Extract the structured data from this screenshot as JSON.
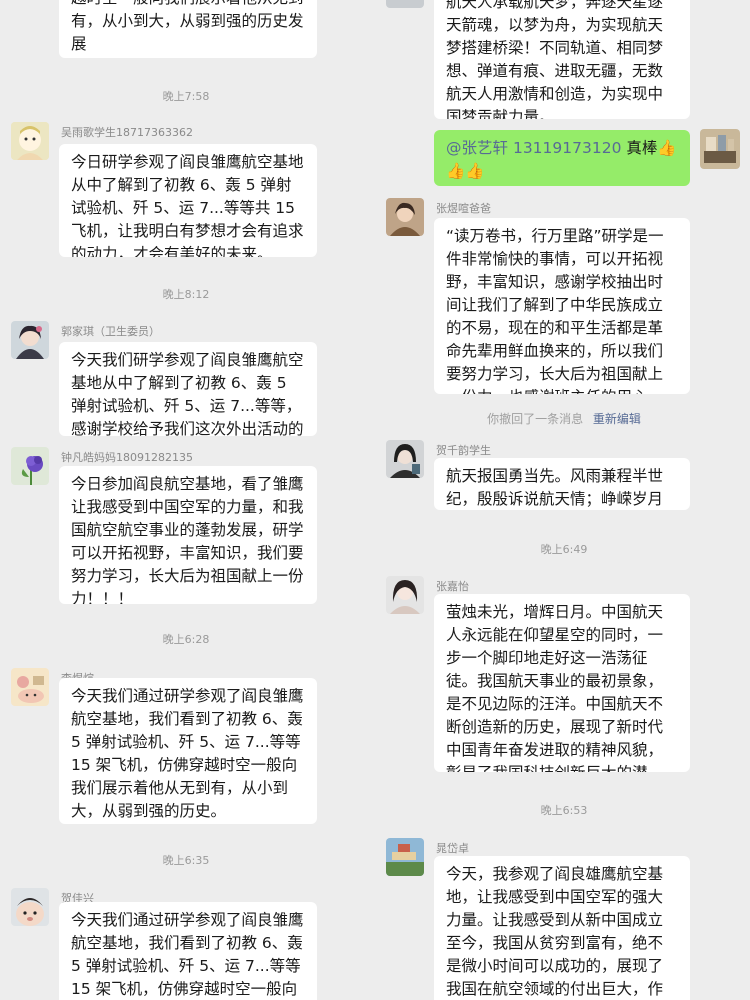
{
  "left": {
    "top_bubble_text": "越时空一般向我们展示着他从无到有，从小到大，从弱到强的历史发展",
    "time1": "晚上7:58",
    "msg1": {
      "name": "吴雨歌学生18717363362",
      "text": "今日研学参观了阎良雏鹰航空基地从中了解到了初教 6、轰 5 弹射试验机、歼 5、运 7...等等共 15 飞机，让我明白有梦想才会有追求的动力，才会有美好的未来。"
    },
    "time2": "晚上8:12",
    "msg2": {
      "name": "郭家琪（卫生委员）",
      "text": "今天我们研学参观了阎良雏鹰航空基地从中了解到了初教 6、轰 5 弹射试验机、歼 5、运 7...等等，感谢学校给予我们这次外出活动的机会"
    },
    "msg3": {
      "name": "钟凡皓妈妈18091282135",
      "text": "今日参加阎良航空基地，看了雏鹰让我感受到中国空军的力量，和我国航空航空事业的蓬勃发展，研学可以开拓视野，丰富知识，我们要努力学习，长大后为祖国献上一份力！！！"
    },
    "time3": "晚上6:28",
    "msg4": {
      "name": "李煜煊",
      "text": "今天我们通过研学参观了阎良雏鹰航空基地，我们看到了初教 6、轰 5 弹射试验机、歼 5、运 7...等等 15 架飞机，仿佛穿越时空一般向我们展示着他从无到有，从小到大，从弱到强的历史。"
    },
    "time4": "晚上6:35",
    "msg5": {
      "name": "贺佳兴",
      "text": "今天我们通过研学参观了阎良雏鹰航空基地，我们看到了初教 6、轰 5 弹射试验机、歼 5、运 7...等等 15 架飞机，仿佛穿越时空一般向我们展示着他从无到有"
    }
  },
  "right": {
    "top_bubble_text": "航天人承载航天梦，奔逐天星逐天箭魂，以梦为舟，为实现航天梦搭建桥梁！不同轨道、相同梦想、弹道有痕、进取无疆，无数航天人用激情和创造，为实现中国梦贡献力量。",
    "self_msg": {
      "mention": "@张艺轩",
      "phone": "13119173120",
      "text": " 真棒👍👍👍"
    },
    "msg1": {
      "name": "张煜喧爸爸",
      "text": "“读万卷书，行万里路”研学是一件非常愉快的事情，可以开拓视野，丰富知识，感谢学校抽出时间让我们了解到了中华民族成立的不易，现在的和平生活都是革命先辈用鲜血换来的，所以我们要努力学习，长大后为祖国献上一份力。也感谢班主任的用心，让我们学有所获。"
    },
    "recall": {
      "text": "你撤回了一条消息",
      "link": "重新编辑"
    },
    "msg2": {
      "name": "贺千韵学生",
      "text": "航天报国勇当先。风雨兼程半世纪，殷殷诉说航天情；峥嵘岁月写壮志"
    },
    "time1": "晚上6:49",
    "msg3": {
      "name": "张嘉怡",
      "text": "萤烛未光，增辉日月。中国航天人永远能在仰望星空的同时，一步一个脚印地走好这一浩荡征徒。我国航天事业的最初景象，是不见边际的汪洋。中国航天不断创造新的历史，展现了新时代中国青年奋发进取的精神风貌，彰显了我国科技创新巨大的潜力。"
    },
    "time2": "晚上6:53",
    "msg4": {
      "name": "晁岱卓",
      "text": "今天，我参观了阎良雄鹰航空基地，让我感受到中国空军的强大力量。让我感受到从新中国成立至今，我国从贫穷到富有，绝不是微小时间可以成功的，展现了我国在航空领域的付出巨大，作为青少年的我们应该为国家的未来着想，为国家的"
    }
  }
}
